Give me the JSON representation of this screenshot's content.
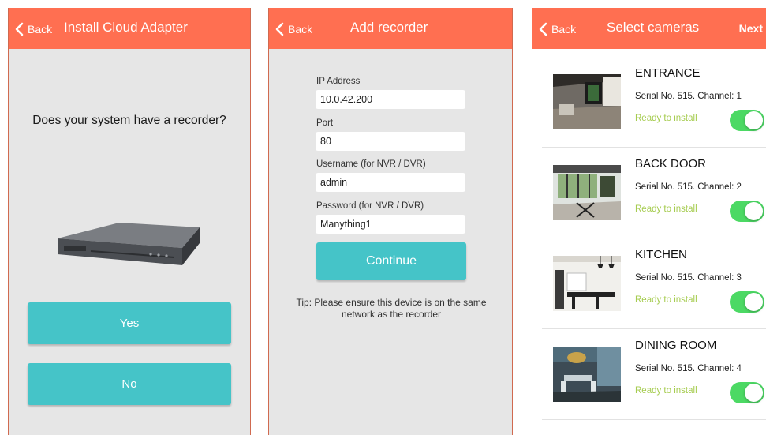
{
  "colors": {
    "header": "#ff6f51",
    "button": "#45c4c8",
    "toggle_on": "#4cd964",
    "status": "#a6cc50",
    "screen_bg": "#e6e6e6"
  },
  "screen1": {
    "back_label": "Back",
    "title": "Install Cloud Adapter",
    "question": "Does your system have a recorder?",
    "image": "dvr-recorder-image",
    "yes_label": "Yes",
    "no_label": "No"
  },
  "screen2": {
    "back_label": "Back",
    "title": "Add recorder",
    "fields": [
      {
        "label": "IP Address",
        "value": "10.0.42.200"
      },
      {
        "label": "Port",
        "value": "80"
      },
      {
        "label": "Username (for NVR / DVR)",
        "value": "admin"
      },
      {
        "label": "Password (for NVR / DVR)",
        "value": "Manything1"
      }
    ],
    "continue_label": "Continue",
    "tip": "Tip: Please ensure this device is on the same network as the recorder"
  },
  "screen3": {
    "back_label": "Back",
    "title": "Select cameras",
    "next_label": "Next",
    "cameras": [
      {
        "name": "ENTRANCE",
        "serial": "Serial No. 515. Channel: 1",
        "status": "Ready to install",
        "enabled": true
      },
      {
        "name": "BACK DOOR",
        "serial": "Serial No. 515. Channel: 2",
        "status": "Ready to install",
        "enabled": true
      },
      {
        "name": "KITCHEN",
        "serial": "Serial No. 515. Channel: 3",
        "status": "Ready to install",
        "enabled": true
      },
      {
        "name": "DINING ROOM",
        "serial": "Serial No. 515. Channel: 4",
        "status": "Ready to install",
        "enabled": true
      }
    ]
  }
}
